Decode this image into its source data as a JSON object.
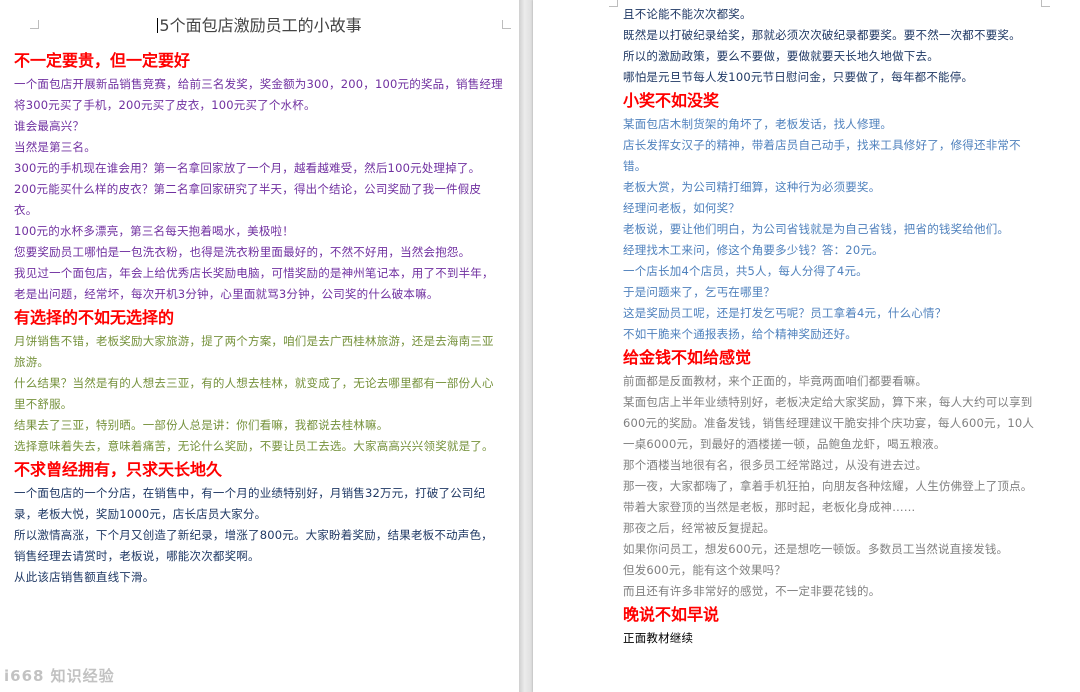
{
  "document": {
    "title": "5个面包店激励员工的小故事"
  },
  "left_page": {
    "sections": [
      {
        "heading": "不一定要贵，但一定要好",
        "color": "#7030a0",
        "paragraphs": [
          "一个面包店开展新品销售竞赛，给前三名发奖，奖金额为300，200，100元的奖品，销售经理将300元买了手机，200元买了皮衣，100元买了个水杯。",
          "谁会最高兴？",
          "当然是第三名。",
          "300元的手机现在谁会用？第一名拿回家放了一个月，越看越难受，然后100元处理掉了。",
          "200元能买什么样的皮衣？第二名拿回家研究了半天，得出个结论，公司奖励了我一件假皮衣。",
          "100元的水杯多漂亮，第三名每天抱着喝水，美极啦！",
          "您要奖励员工哪怕是一包洗衣粉，也得是洗衣粉里面最好的，不然不好用，当然会抱怨。",
          "我见过一个面包店，年会上给优秀店长奖励电脑，可惜奖励的是神州笔记本，用了不到半年，老是出问题，经常坏，每次开机3分钟，心里面就骂3分钟，公司奖的什么破本嘛。"
        ]
      },
      {
        "heading": "有选择的不如无选择的",
        "color": "#76923c",
        "paragraphs": [
          "月饼销售不错，老板奖励大家旅游，提了两个方案，咱们是去广西桂林旅游，还是去海南三亚旅游。",
          "什么结果？当然是有的人想去三亚，有的人想去桂林，就变成了，无论去哪里都有一部份人心里不舒服。",
          "结果去了三亚，特别晒。一部份人总是讲：你们看嘛，我都说去桂林嘛。",
          "选择意味着失去，意味着痛苦，无论什么奖励，不要让员工去选。大家高高兴兴领奖就是了。"
        ]
      },
      {
        "heading": "不求曾经拥有，只求天长地久",
        "color": "#1f3864",
        "paragraphs": [
          "一个面包店的一个分店，在销售中，有一个月的业绩特别好，月销售32万元，打破了公司纪录，老板大悦，奖励1000元，店长店员大家分。",
          "所以激情高涨，下个月又创造了新纪录，增涨了800元。大家盼着奖励，结果老板不动声色，销售经理去请赏时，老板说，哪能次次都奖啊。",
          "从此该店销售额直线下滑。"
        ]
      }
    ]
  },
  "right_page": {
    "sections": [
      {
        "heading": "",
        "color": "#1f3864",
        "paragraphs": [
          "且不论能不能次次都奖。",
          "既然是以打破纪录给奖，那就必须次次破纪录都要奖。要不然一次都不要奖。",
          "所以的激励政策，要么不要做，要做就要天长地久地做下去。",
          "哪怕是元旦节每人发100元节日慰问金，只要做了，每年都不能停。"
        ]
      },
      {
        "heading": "小奖不如没奖",
        "color": "#4f81bd",
        "paragraphs": [
          "某面包店木制货架的角坏了，老板发话，找人修理。",
          "店长发挥女汉子的精神，带着店员自己动手，找来工具修好了，修得还非常不错。",
          "老板大赏，为公司精打细算，这种行为必须要奖。",
          "经理问老板，如何奖？",
          "老板说，要让他们明白，为公司省钱就是为自己省钱，把省的钱奖给他们。",
          "经理找木工来问，修这个角要多少钱？答：20元。",
          "一个店长加4个店员，共5人，每人分得了4元。",
          "于是问题来了，乞丐在哪里？",
          "这是奖励员工呢，还是打发乞丐呢？员工拿着4元，什么心情？",
          "不如干脆来个通报表扬，给个精神奖励还好。"
        ]
      },
      {
        "heading": "给金钱不如给感觉",
        "color": "#808080",
        "paragraphs": [
          "前面都是反面教材，来个正面的，毕竟两面咱们都要看嘛。",
          "某面包店上半年业绩特别好，老板决定给大家奖励，算下来，每人大约可以享到600元的奖励。准备发钱，销售经理建议干脆安排个庆功宴，每人600元，10人一桌6000元，到最好的酒楼搓一顿，品鲍鱼龙虾，喝五粮液。",
          "那个酒楼当地很有名，很多员工经常路过，从没有进去过。",
          "那一夜，大家都嗨了，拿着手机狂拍，向朋友各种炫耀，人生仿佛登上了顶点。带着大家登顶的当然是老板，那时起，老板化身成神……",
          "那夜之后，经常被反复提起。",
          "如果你问员工，想发600元，还是想吃一顿饭。多数员工当然说直接发钱。",
          "但发600元，能有这个效果吗？",
          "而且还有许多非常好的感觉，不一定非要花钱的。"
        ]
      },
      {
        "heading": "晚说不如早说",
        "color": "#000000",
        "paragraphs": [
          "正面教材继续"
        ]
      }
    ]
  },
  "watermark": "i668 知识经验"
}
